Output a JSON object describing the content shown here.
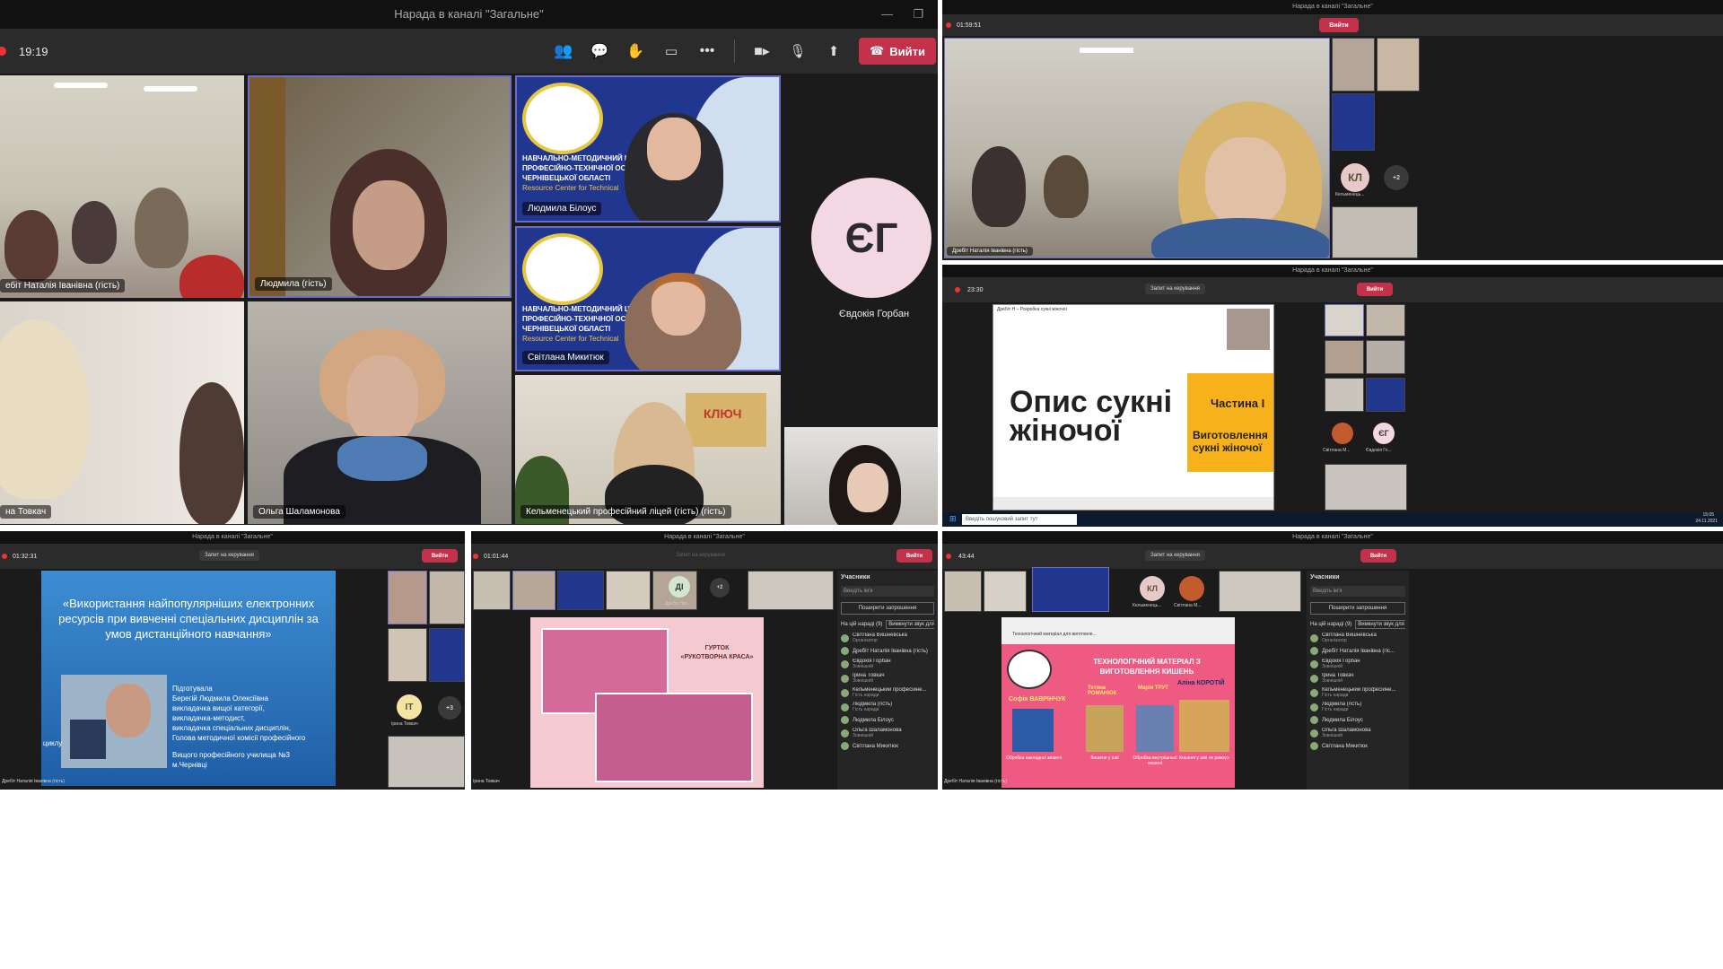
{
  "main": {
    "title": "Нарада в каналі \"Загальне\"",
    "time": "19:19",
    "leave_label": "Вийти",
    "participants": [
      {
        "name": "ебіт Наталія Іванівна (гість)"
      },
      {
        "name": "Людмила (гість)"
      },
      {
        "name": "Людмила Білоус"
      },
      {
        "name": "Світлана Микитюк"
      },
      {
        "name": "на Товкач"
      },
      {
        "name": "Ольга Шаламонова"
      },
      {
        "name": "Кельменецький професійний ліцей (гість) (гість)"
      }
    ],
    "logo_lines": [
      "НАВЧАЛЬНО-МЕТОДИЧНИЙ ЦЕНТ",
      "ПРОФЕСІЙНО-ТЕХНІЧНОЇ ОСВІ",
      "ЧЕРНІВЕЦЬКОЇ ОБЛАСТІ",
      "Resource Center for Technical"
    ],
    "avatar": {
      "initials": "ЄГ",
      "name": "Євдокія Горбан",
      "color": "#f3d8e3"
    },
    "colors": {
      "accent": "#6b6cc4",
      "leave": "#c4314b",
      "logo_bg": "#20368f"
    }
  },
  "top_right": {
    "time": "01:59:51",
    "title": "Нарада в каналі \"Загальне\"",
    "presenter": "Дребіт Наталія Іванівна (гість)",
    "avatar_initials": "КЛ",
    "avatar_caption": "Кельменець...",
    "more": "+2"
  },
  "mid_right": {
    "title": "Нарада в каналі \"Загальне\"",
    "time": "23:30",
    "control_label": "Запит на керування",
    "slide_title_1": "Опис сукні",
    "slide_title_2": "жіночої",
    "slide_part": "Частина І",
    "slide_sub_1": "Виготовлення",
    "slide_sub_2": "сукні жіночої",
    "window_title": "Дребіт Н – Розробка сукні жіночої",
    "search_placeholder": "Введіть пошуковий запит тут",
    "clock": "15:05",
    "date": "24.11.2021",
    "avatar_initials": "ЄГ",
    "names": [
      "Світлана М...",
      "Євдокія Го..."
    ]
  },
  "bottom_left": {
    "title": "Нарада в каналі \"Загальне\"",
    "time": "01:32:31",
    "control_label": "Запит на керування",
    "slide_heading": "«Використання найпопулярніших електронних ресурсів при вивченні спеціальних дисциплін за умов дистанційного навчання»",
    "author_lines": [
      "Підготувала",
      "Берегій Людмила Олексіївна",
      "викладачка вищої категорії,",
      "викладачка-методист,",
      "викладачка спеціальних дисциплін,",
      "Голова методичної комісії професійного",
      "циклу",
      "Вищого професійного училища №3",
      "м.Чернівці"
    ],
    "avatar_initials": "ІТ",
    "avatar_caption": "Ірина Товкач",
    "more": "+3",
    "presenter": "Дребіт Наталія Іванівна (гість)"
  },
  "bottom_mid": {
    "title": "Нарада в каналі \"Загальне\"",
    "time": "01:01:44",
    "control_label": "Запит на керування",
    "avatar_initials": "ДІ",
    "avatar_caption": "Дребіт Нат...",
    "more": "+2",
    "slide_label_1": "ГУРТОК",
    "slide_label_2": "«РУКОТВОРНА КРАСА»",
    "presenter": "Ірина Товкач",
    "sidebar_title": "Учасники",
    "sidebar_search": "Введіть ім'я",
    "share_label": "Поширити запрошення",
    "in_meeting": "На цій нараді (9)",
    "mute_all": "Вимкнути звук для всіх",
    "members": [
      {
        "name": "Світлана Вишневська",
        "role": "Організатор"
      },
      {
        "name": "Дребіт Наталія Іванівна (гість)",
        "role": ""
      },
      {
        "name": "Євдокія Горбан",
        "role": "Зовнішній"
      },
      {
        "name": "Ірина Товкач",
        "role": "Зовнішній"
      },
      {
        "name": "Кельменецький професійне...",
        "role": "Гість наради"
      },
      {
        "name": "Людмила (гість)",
        "role": "Гість наради"
      },
      {
        "name": "Людмила Білоус",
        "role": ""
      },
      {
        "name": "Ольга Шаламонова",
        "role": "Зовнішній"
      },
      {
        "name": "Світлана Микитюк",
        "role": ""
      }
    ]
  },
  "bottom_right": {
    "title": "Нарада в каналі \"Загальне\"",
    "time": "43:44",
    "control_label": "Запит на керування",
    "avatar_initials": "КЛ",
    "avatar_caption_1": "Кельменець...",
    "avatar_caption_2": "Світлана М...",
    "slide_title_1": "ТЕХНОЛОГІЧНИЙ МАТЕРІАЛ З",
    "slide_title_2": "ВИГОТОВЛЕННЯ КИШЕНЬ",
    "names": [
      "Софія ВАВРІНЧУК",
      "Тетяна РОМАНЮК",
      "Марія ТРУТ",
      "Аліна КОРОТІЙ"
    ],
    "captions": [
      "Обробка накладної кишені",
      "Кишеня у шві",
      "Обробка внутрішньої кишені",
      "Кишеня у шві «в рамку»"
    ],
    "doc_title": "Технологічний матеріал для виготовле...",
    "presenter": "Дребіт Наталія Іванівна (гість)",
    "sidebar_title": "Учасники",
    "sidebar_search": "Введіть ім'я",
    "share_label": "Поширити запрошення",
    "in_meeting": "На цій нараді (9)",
    "mute_all": "Вимкнути звук для всіх",
    "members": [
      {
        "name": "Світлана Вишневська",
        "role": "Організатор"
      },
      {
        "name": "Дребіт Наталія Іванівна (гіс...",
        "role": ""
      },
      {
        "name": "Євдокія Горбан",
        "role": "Зовнішній"
      },
      {
        "name": "Ірина Товкач",
        "role": "Зовнішній"
      },
      {
        "name": "Кельменецький професійне...",
        "role": "Гість наради"
      },
      {
        "name": "Людмила (гість)",
        "role": "Гість наради"
      },
      {
        "name": "Людмила Білоус",
        "role": ""
      },
      {
        "name": "Ольга Шаламонова",
        "role": "Зовнішній"
      },
      {
        "name": "Світлана Микитюк",
        "role": ""
      }
    ]
  }
}
